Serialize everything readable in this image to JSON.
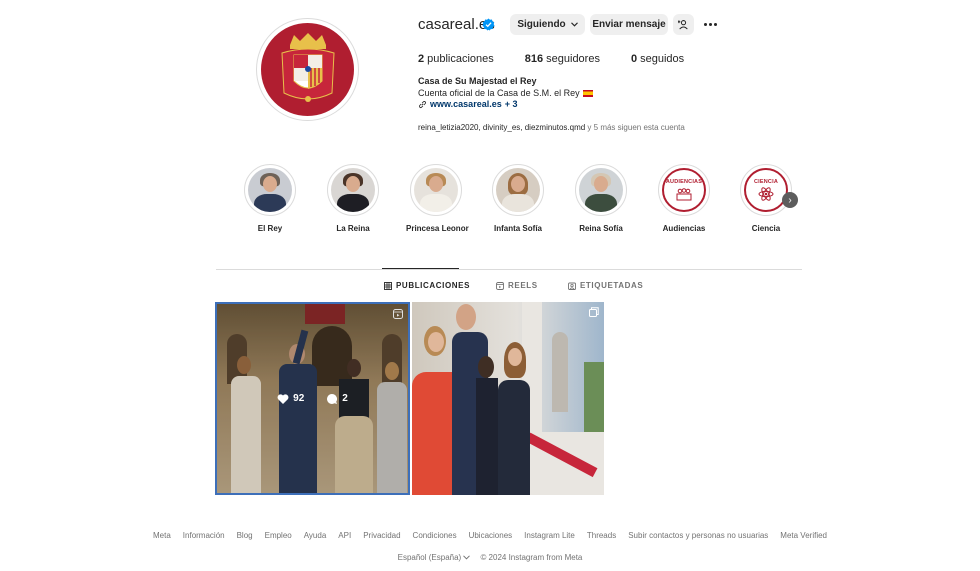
{
  "profile": {
    "username": "casareal.es",
    "following_button": "Siguiendo",
    "message_button": "Enviar mensaje",
    "stats": [
      {
        "count": "2",
        "label": "publicaciones"
      },
      {
        "count": "816",
        "label": "seguidores"
      },
      {
        "count": "0",
        "label": "seguidos"
      }
    ],
    "bio_name": "Casa de Su Majestad el Rey",
    "bio_desc": "Cuenta oficial de la Casa de S.M. el Rey",
    "link_text": "www.casareal.es",
    "link_more": "+ 3",
    "followed_by_names": "reina_letizia2020, divinity_es, diezminutos.qmd",
    "followed_by_suffix": " y 5 más siguen esta cuenta",
    "brand_color": "#b01e30",
    "verified_color": "#0095f6"
  },
  "highlights": [
    {
      "label": "El Rey"
    },
    {
      "label": "La Reina"
    },
    {
      "label": "Princesa Leonor"
    },
    {
      "label": "Infanta Sofía"
    },
    {
      "label": "Reina Sofía"
    },
    {
      "label": "Audiencias",
      "badge": "AUDIENCIAS"
    },
    {
      "label": "Ciencia",
      "badge": "CIENCIA"
    }
  ],
  "tabs": [
    {
      "label": "PUBLICACIONES",
      "icon": "grid-icon",
      "active": true
    },
    {
      "label": "REELS",
      "icon": "reels-icon",
      "active": false
    },
    {
      "label": "ETIQUETADAS",
      "icon": "tagged-icon",
      "active": false
    }
  ],
  "posts": [
    {
      "likes": "92",
      "comments": "2"
    }
  ],
  "footer": {
    "links": [
      "Meta",
      "Información",
      "Blog",
      "Empleo",
      "Ayuda",
      "API",
      "Privacidad",
      "Condiciones",
      "Ubicaciones",
      "Instagram Lite",
      "Threads",
      "Subir contactos y personas no usuarias",
      "Meta Verified"
    ],
    "language": "Español (España)",
    "copyright": "© 2024 Instagram from Meta"
  }
}
